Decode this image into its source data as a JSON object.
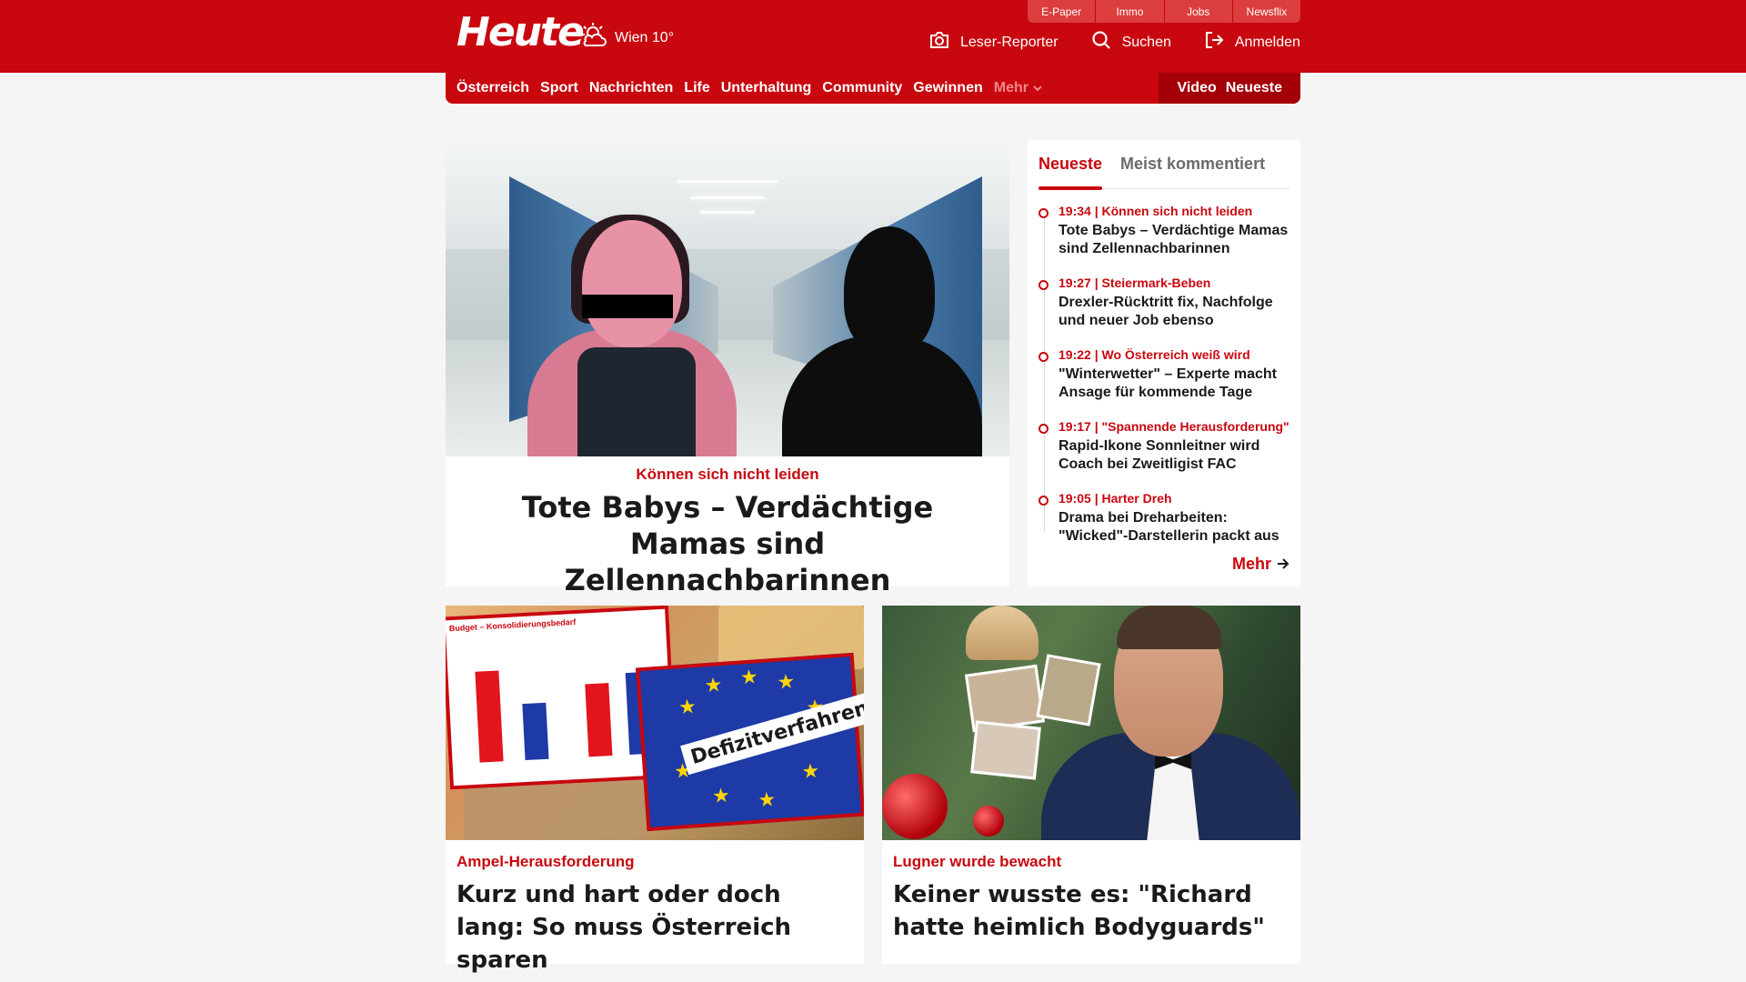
{
  "header": {
    "toplinks": [
      "E-Paper",
      "Immo",
      "Jobs",
      "Newsflix"
    ],
    "logo": "Heute",
    "weather": {
      "icon": "sun-cloud-icon",
      "text": "Wien 10°"
    },
    "actions": [
      {
        "icon": "camera-icon",
        "label": "Leser-Reporter"
      },
      {
        "icon": "search-icon",
        "label": "Suchen"
      },
      {
        "icon": "login-icon",
        "label": "Anmelden"
      }
    ]
  },
  "nav": {
    "items": [
      "Österreich",
      "Sport",
      "Nachrichten",
      "Life",
      "Unterhaltung",
      "Community",
      "Gewinnen"
    ],
    "more": "Mehr",
    "right": [
      "Video",
      "Neueste"
    ]
  },
  "hero": {
    "kicker": "Können sich nicht leiden",
    "title": "Tote Babys – Verdächtige Mamas sind Zellennachbarinnen"
  },
  "sidebar": {
    "tabs": [
      "Neueste",
      "Meist kommentiert"
    ],
    "items": [
      {
        "meta": "19:34 | Können sich nicht leiden",
        "title": "Tote Babys – Verdächtige Mamas sind Zellennachbarinnen"
      },
      {
        "meta": "19:27 | Steiermark-Beben",
        "title": "Drexler-Rücktritt fix, Nachfolge und neuer Job ebenso"
      },
      {
        "meta": "19:22 | Wo Österreich weiß wird",
        "title": "\"Winterwetter\" – Experte macht Ansage für kommende Tage"
      },
      {
        "meta": "19:17 | \"Spannende Herausforderung\"",
        "title": "Rapid-Ikone Sonnleitner wird Coach bei Zweitligist FAC"
      },
      {
        "meta": "19:05 | Harter Dreh",
        "title": "Drama bei Dreharbeiten: \"Wicked\"-Darstellerin packt aus"
      }
    ],
    "more": "Mehr"
  },
  "cards": [
    {
      "kicker": "Ampel-Herausforderung",
      "title": "Kurz und hart oder doch lang: So muss Österreich sparen",
      "image_text": {
        "chart_title": "Budget – Konsolidierungsbedarf",
        "label": "Defizitverfahren"
      }
    },
    {
      "kicker": "Lugner wurde bewacht",
      "title": "Keiner wusste es: \"Richard hatte heimlich Bodyguards\""
    }
  ],
  "colors": {
    "brand": "#c8070f",
    "brand_dark": "#a40009",
    "background": "#f5f5f5"
  }
}
